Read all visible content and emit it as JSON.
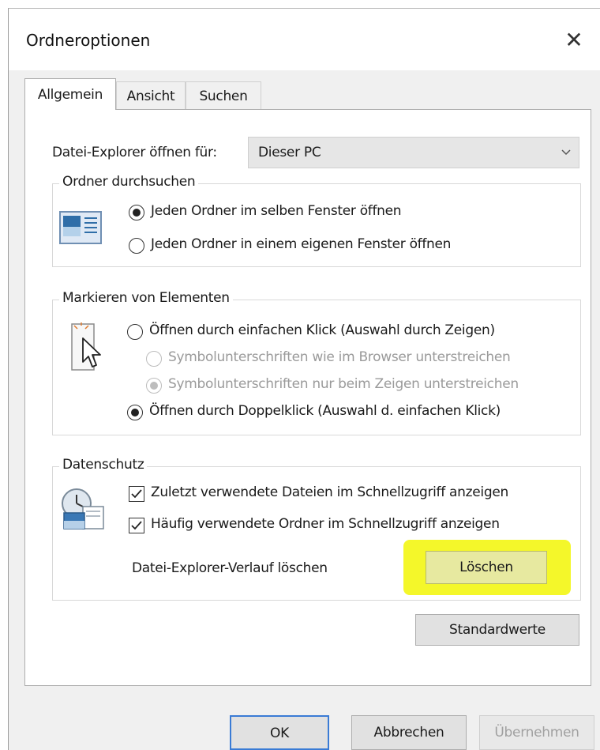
{
  "window": {
    "title": "Ordneroptionen"
  },
  "tabs": [
    {
      "label": "Allgemein"
    },
    {
      "label": "Ansicht"
    },
    {
      "label": "Suchen"
    }
  ],
  "explorer_open": {
    "label": "Datei-Explorer öffnen für:",
    "value": "Dieser PC"
  },
  "browse_folders": {
    "legend": "Ordner durchsuchen",
    "options": [
      {
        "label": "Jeden Ordner im selben Fenster öffnen",
        "checked": true
      },
      {
        "label": "Jeden Ordner in einem eigenen Fenster öffnen",
        "checked": false
      }
    ]
  },
  "click_items": {
    "legend": "Markieren von Elementen",
    "options": [
      {
        "label": "Öffnen durch einfachen Klick (Auswahl durch Zeigen)",
        "checked": false,
        "enabled": true
      },
      {
        "label": "Symbolunterschriften wie im Browser unterstreichen",
        "checked": false,
        "enabled": false
      },
      {
        "label": "Symbolunterschriften nur beim Zeigen unterstreichen",
        "checked": true,
        "enabled": false
      },
      {
        "label": "Öffnen durch Doppelklick (Auswahl d. einfachen Klick)",
        "checked": true,
        "enabled": true
      }
    ]
  },
  "privacy": {
    "legend": "Datenschutz",
    "checkboxes": [
      {
        "label": "Zuletzt verwendete Dateien im Schnellzugriff anzeigen",
        "checked": true
      },
      {
        "label": "Häufig verwendete Ordner im Schnellzugriff anzeigen",
        "checked": true
      }
    ],
    "clear_label": "Datei-Explorer-Verlauf löschen",
    "clear_button": "Löschen",
    "highlight_color": "#f4f72a"
  },
  "defaults_button": "Standardwerte",
  "buttons": {
    "ok": "OK",
    "cancel": "Abbrechen",
    "apply": "Übernehmen"
  }
}
